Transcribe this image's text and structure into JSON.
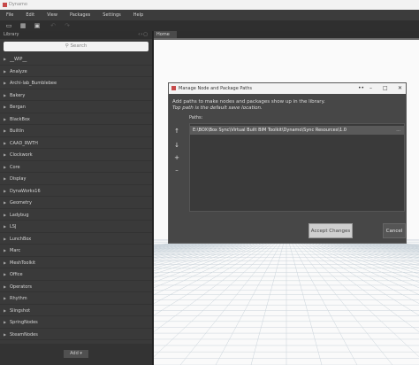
{
  "window": {
    "title": "Dynamo"
  },
  "menu": [
    "File",
    "Edit",
    "View",
    "Packages",
    "Settings",
    "Help"
  ],
  "toolbar": {
    "icons": [
      "new-file-icon",
      "open-folder-icon",
      "save-icon",
      "undo-icon",
      "redo-icon"
    ]
  },
  "library": {
    "title": "Library",
    "search_placeholder": "Search",
    "items": [
      "__WIP__",
      "Analyze",
      "Archi-lab_Bumblebee",
      "Bakery",
      "Bergan",
      "BlackBox",
      "BuiltIn",
      "CAAD_RWTH",
      "Clockwork",
      "Core",
      "Display",
      "DynaWorks16",
      "Geometry",
      "Ladybug",
      "LSJ",
      "LunchBox",
      "Marc",
      "MeshToolkit",
      "Office",
      "Operators",
      "Rhythm",
      "Slingshot",
      "SpringNodes",
      "SteamNodes"
    ],
    "add_label": "Add"
  },
  "workspace": {
    "tab_label": "Home"
  },
  "dialog": {
    "title": "Manage Node and Package Paths",
    "description": "Add paths to make nodes and packages show up in the library.",
    "note": "Top path is the default save location.",
    "paths_label": "Paths:",
    "paths": [
      "E:\\BOX\\Box Sync\\Virtual Built BIM Toolkit\\Dynamo\\Sync Resources\\1.0"
    ],
    "path_more": "...",
    "accept_label": "Accept Changes",
    "cancel_label": "Cancel"
  }
}
